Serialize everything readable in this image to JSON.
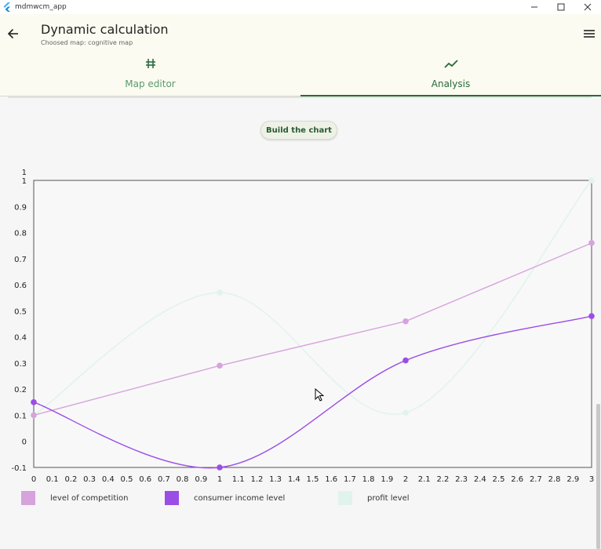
{
  "window": {
    "title": "mdmwcm_app"
  },
  "header": {
    "title": "Dynamic calculation",
    "subtitle": "Choosed map: cognitive map"
  },
  "tabs": [
    {
      "label": "Map editor",
      "icon": "hash-icon"
    },
    {
      "label": "Analysis",
      "icon": "trending-up-icon"
    }
  ],
  "actions": {
    "build_label": "Build the chart"
  },
  "colors": {
    "accent": "#2a6a3c",
    "appbar_bg": "#fbfbf1"
  },
  "chart_data": {
    "type": "line",
    "x": [
      0,
      1,
      2,
      3
    ],
    "xlim": [
      0,
      3
    ],
    "ylim": [
      -0.1,
      1
    ],
    "x_ticks": [
      "0",
      "0.1",
      "0.2",
      "0.3",
      "0.4",
      "0.5",
      "0.6",
      "0.7",
      "0.8",
      "0.9",
      "1",
      "1.1",
      "1.2",
      "1.3",
      "1.4",
      "1.5",
      "1.6",
      "1.7",
      "1.8",
      "1.9",
      "2",
      "2.1",
      "2.2",
      "2.3",
      "2.4",
      "2.5",
      "2.6",
      "2.7",
      "2.8",
      "2.9",
      "3"
    ],
    "y_ticks": [
      "-0.1",
      "0",
      "0.1",
      "0.2",
      "0.3",
      "0.4",
      "0.5",
      "0.6",
      "0.7",
      "0.8",
      "0.9",
      "1",
      "1"
    ],
    "legend_position": "bottom",
    "series": [
      {
        "name": "level of competition",
        "color": "#d6a3dd",
        "values": [
          0.1,
          0.29,
          0.46,
          0.76
        ],
        "curve": "linear"
      },
      {
        "name": "consumer income level",
        "color": "#9b4ee6",
        "values": [
          0.15,
          -0.1,
          0.31,
          0.48
        ],
        "curve": "smooth"
      },
      {
        "name": "profit level",
        "color": "#e0f3ec",
        "values": [
          0.1,
          0.57,
          0.11,
          1.0
        ],
        "curve": "smooth"
      }
    ]
  }
}
